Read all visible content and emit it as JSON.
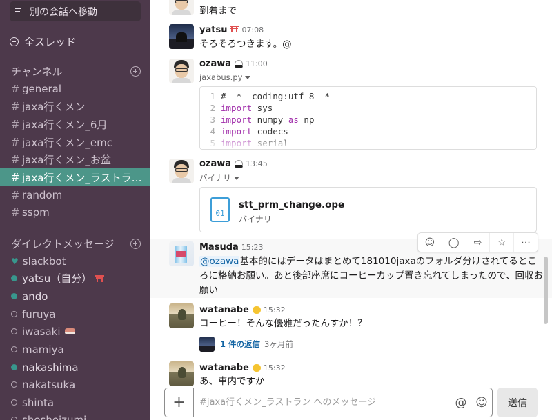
{
  "sidebar": {
    "switcher_label": "別の会話へ移動",
    "threads_label": "全スレッド",
    "channels_header": "チャンネル",
    "channels": [
      {
        "name": "general"
      },
      {
        "name": "jaxa行くメン"
      },
      {
        "name": "jaxa行くメン_6月"
      },
      {
        "name": "jaxa行くメン_emc"
      },
      {
        "name": "jaxa行くメン_お盆"
      },
      {
        "name": "jaxa行くメン_ラストラ…",
        "active": true
      },
      {
        "name": "random"
      },
      {
        "name": "sspm"
      }
    ],
    "dm_header": "ダイレクトメッセージ",
    "dms": [
      {
        "name": "slackbot",
        "status": "bot"
      },
      {
        "name": "yatsu（自分）",
        "status": "online",
        "emoji": "torii"
      },
      {
        "name": "ando",
        "status": "online"
      },
      {
        "name": "furuya",
        "status": "offline"
      },
      {
        "name": "iwasaki",
        "status": "offline",
        "emoji": "sushi"
      },
      {
        "name": "mamiya",
        "status": "offline"
      },
      {
        "name": "nakashima",
        "status": "online"
      },
      {
        "name": "nakatsuka",
        "status": "offline"
      },
      {
        "name": "shinta",
        "status": "offline"
      },
      {
        "name": "shoshoizumi",
        "status": "offline"
      }
    ]
  },
  "messages": {
    "m0": {
      "text": "到着まで"
    },
    "m1": {
      "user": "yatsu",
      "time": "07:08",
      "text": "そろそろつきます。@"
    },
    "m2": {
      "user": "ozawa",
      "time": "11:00",
      "file_label": "jaxabus.py"
    },
    "code_lines": [
      {
        "n": "1",
        "src": "# -*- coding:utf-8 -*-"
      },
      {
        "n": "2",
        "src": "import sys"
      },
      {
        "n": "3",
        "src": "import numpy as np"
      },
      {
        "n": "4",
        "src": "import codecs"
      },
      {
        "n": "5",
        "src": "import serial"
      }
    ],
    "m3": {
      "user": "ozawa",
      "time": "13:45",
      "file_label": "バイナリ",
      "file_name": "stt_prm_change.ope",
      "file_type": "バイナリ",
      "file_icon_text": "01"
    },
    "m4": {
      "user": "Masuda",
      "time": "15:23",
      "mention": "@ozawa",
      "text": "基本的にはデータはまとめて181010jaxaのフォルダ分けされてるところに格納お願い。あと後部座席にコーヒーカップ置き忘れてしまったので、回収お願い"
    },
    "m5": {
      "user": "watanabe",
      "time": "15:32",
      "text": "コーヒー！そんな優雅だったんすか！？",
      "thread_replies": "1 件の返信",
      "thread_ago": "3ヶ月前"
    },
    "m6": {
      "user": "watanabe",
      "time": "15:32",
      "text": "あ、車内ですか"
    }
  },
  "composer": {
    "placeholder": "#jaxa行くメン_ラストラン へのメッセージ",
    "send_label": "送信"
  }
}
